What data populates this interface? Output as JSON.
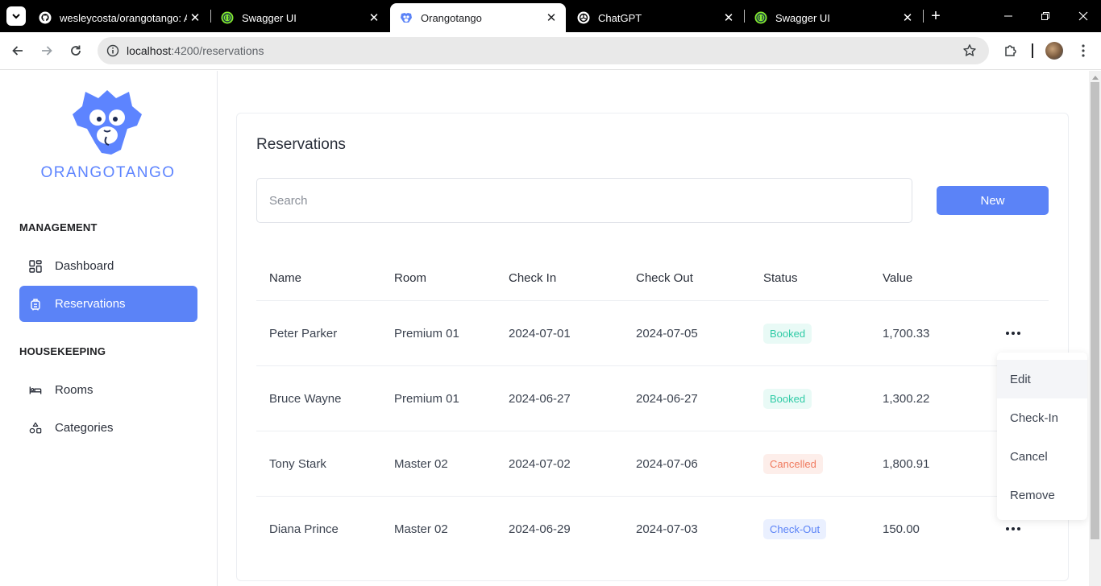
{
  "browser": {
    "tabs": [
      {
        "title": "wesleycosta/orangotango: A",
        "icon": "github-icon"
      },
      {
        "title": "Swagger UI",
        "icon": "swagger-icon"
      },
      {
        "title": "Orangotango",
        "icon": "orangotango-icon"
      },
      {
        "title": "ChatGPT",
        "icon": "chatgpt-icon"
      },
      {
        "title": "Swagger UI",
        "icon": "swagger-icon"
      }
    ],
    "active_tab": 2,
    "url_host": "localhost",
    "url_path": ":4200/reservations"
  },
  "sidebar": {
    "brand": "ORANGOTANGO",
    "sections": [
      {
        "label": "MANAGEMENT",
        "items": [
          {
            "label": "Dashboard",
            "icon": "dashboard-icon"
          },
          {
            "label": "Reservations",
            "icon": "luggage-icon",
            "active": true
          }
        ]
      },
      {
        "label": "HOUSEKEEPING",
        "items": [
          {
            "label": "Rooms",
            "icon": "bed-icon"
          },
          {
            "label": "Categories",
            "icon": "categories-icon"
          }
        ]
      }
    ]
  },
  "main": {
    "title": "Reservations",
    "search_placeholder": "Search",
    "new_button": "New",
    "columns": [
      "Name",
      "Room",
      "Check In",
      "Check Out",
      "Status",
      "Value"
    ],
    "rows": [
      {
        "name": "Peter Parker",
        "room": "Premium 01",
        "check_in": "2024-07-01",
        "check_out": "2024-07-05",
        "status": "Booked",
        "value": "1,700.33"
      },
      {
        "name": "Bruce Wayne",
        "room": "Premium 01",
        "check_in": "2024-06-27",
        "check_out": "2024-06-27",
        "status": "Booked",
        "value": "1,300.22"
      },
      {
        "name": "Tony Stark",
        "room": "Master 02",
        "check_in": "2024-07-02",
        "check_out": "2024-07-06",
        "status": "Cancelled",
        "value": "1,800.91"
      },
      {
        "name": "Diana Prince",
        "room": "Master 02",
        "check_in": "2024-06-29",
        "check_out": "2024-07-03",
        "status": "Check-Out",
        "value": "150.00"
      }
    ],
    "row_menu": [
      "Edit",
      "Check-In",
      "Cancel",
      "Remove"
    ]
  },
  "colors": {
    "accent": "#5b83f7",
    "booked": "#2fcba6",
    "cancelled": "#f07a5e",
    "checkout": "#5b83f7"
  }
}
